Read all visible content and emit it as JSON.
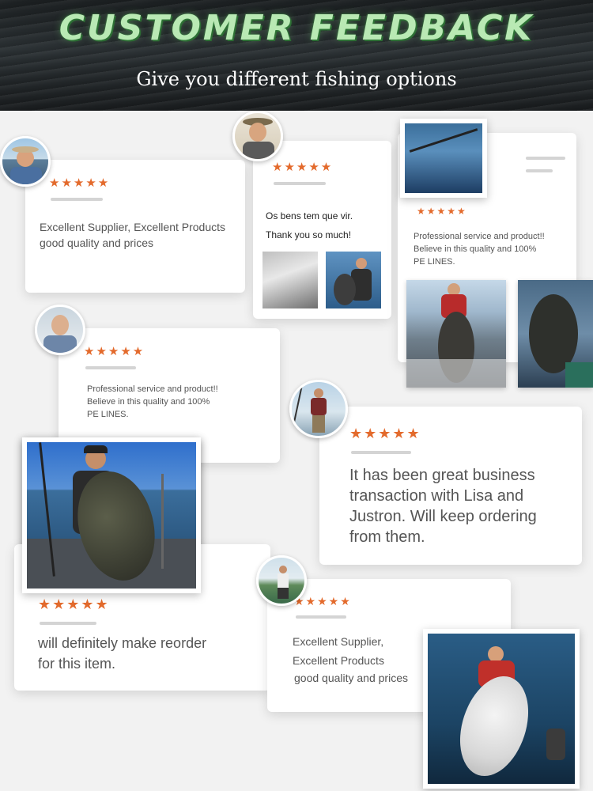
{
  "banner": {
    "title": "CUSTOMER FEEDBACK",
    "subtitle": "Give you different fishing options"
  },
  "rating": "★★★★★",
  "reviews": {
    "r1": {
      "line1": "Excellent Supplier, Excellent Products",
      "line2": "good quality and prices"
    },
    "r2": {
      "line1": "Os bens tem que vir.",
      "line2": "Thank you so much!"
    },
    "r3": {
      "line1": "Professional service and product!!",
      "line2": "Believe in this quality and 100%",
      "line3": "PE LINES."
    },
    "r4": {
      "line1": "Professional service and product!!",
      "line2": "Believe in this quality and 100%",
      "line3": "PE LINES."
    },
    "r5": {
      "line1": "It has been great business",
      "line2": "transaction with Lisa and",
      "line3": "Justron. Will keep ordering",
      "line4": "from them."
    },
    "r6": {
      "line1": "will definitely make reorder",
      "line2": "for this item."
    },
    "r7": {
      "line1": "Excellent Supplier,",
      "line2": "Excellent Products",
      "line3": "good quality and prices"
    }
  },
  "colors": {
    "star": "#e36a2c",
    "title_green": "#b9e9b4"
  }
}
